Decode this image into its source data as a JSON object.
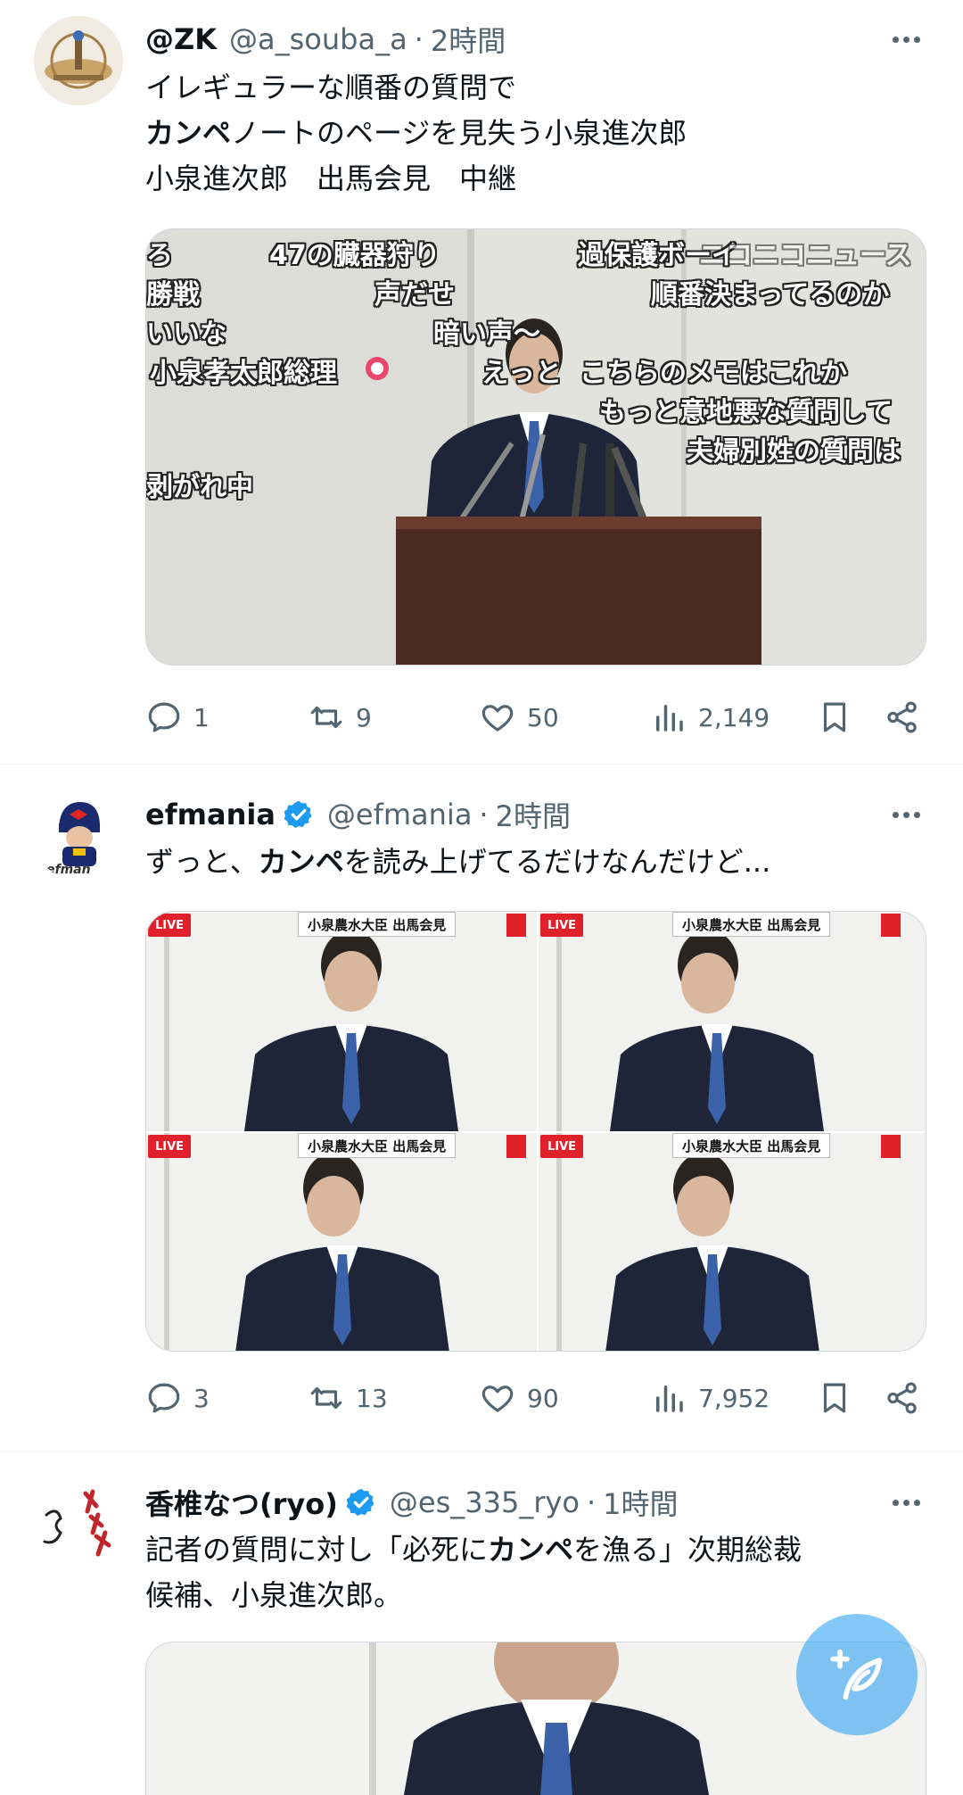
{
  "colors": {
    "accent": "#1d9bf0",
    "text": "#0f1419",
    "secondary": "#536471",
    "border": "#cfd9de"
  },
  "tweets": [
    {
      "name": "@ZK",
      "handle": "@a_souba_a",
      "separator": "·",
      "time": "2時間",
      "verified": false,
      "lines": [
        {
          "pre": "イレギュラーな順番の質問で",
          "bold": "",
          "post": ""
        },
        {
          "pre": "",
          "bold": "カンペ",
          "post": "ノートのページを見失う小泉進次郎"
        },
        {
          "pre": "小泉進次郎　出馬会見　中継",
          "bold": "",
          "post": ""
        }
      ],
      "video_comments": [
        "ろ",
        "47の臓器狩り",
        "過保護ボーイ",
        "ニコニコニュース",
        "勝戦",
        "声だせ",
        "順番決まってるのか",
        "いいな",
        "暗い声〜",
        "小泉孝太郎総理",
        "えっと",
        "こちらのメモはこれか",
        "もっと意地悪な質問して",
        "夫婦別姓の質問は",
        "剥がれ中"
      ],
      "actions": {
        "reply": "1",
        "retweet": "9",
        "like": "50",
        "views": "2,149"
      }
    },
    {
      "name": "efmania",
      "handle": "@efmania",
      "separator": "·",
      "time": "2時間",
      "verified": true,
      "avatar_label": "efman",
      "lines": [
        {
          "pre": "ずっと、",
          "bold": "カンペ",
          "post": "を読み上げてるだけなんだけど..."
        }
      ],
      "grid": [
        {
          "live": "LIVE",
          "caption": "小泉農水大臣 出馬会見"
        },
        {
          "live": "LIVE",
          "caption": "小泉農水大臣 出馬会見"
        },
        {
          "live": "LIVE",
          "caption": "小泉農水大臣 出馬会見"
        },
        {
          "live": "LIVE",
          "caption": "小泉農水大臣 出馬会見"
        }
      ],
      "actions": {
        "reply": "3",
        "retweet": "13",
        "like": "90",
        "views": "7,952"
      }
    },
    {
      "name": "香椎なつ(ryo)",
      "handle": "@es_335_ryo",
      "separator": "·",
      "time": "1時間",
      "verified": true,
      "lines": [
        {
          "pre": "記者の質問に対し「必死に",
          "bold": "カンペ",
          "post": "を漁る」次期総裁"
        },
        {
          "pre": "候補、小泉進次郎。",
          "bold": "",
          "post": ""
        }
      ]
    }
  ],
  "fab": {
    "icon": "compose-icon"
  }
}
